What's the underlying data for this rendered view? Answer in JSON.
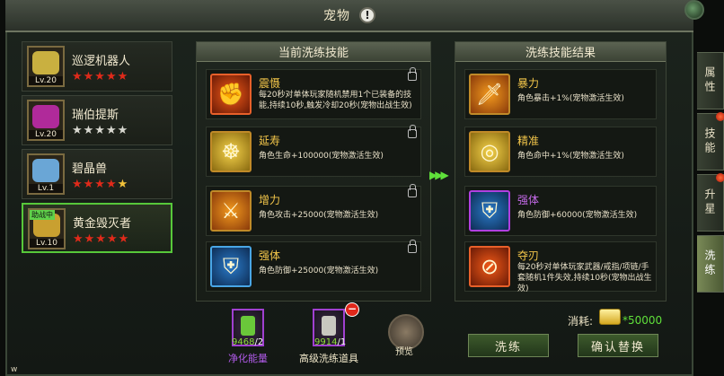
{
  "window": {
    "title": "宠物",
    "corner_mark": "w"
  },
  "pets": [
    {
      "name": "巡逻机器人",
      "level": "Lv.20",
      "stars": "★★★★★",
      "star_style": "red",
      "color": "#c9b040"
    },
    {
      "name": "瑞伯提斯",
      "level": "Lv.20",
      "stars": "★★★★★",
      "star_style": "empty",
      "color": "#b02a9a"
    },
    {
      "name": "碧晶兽",
      "level": "Lv.1",
      "stars_red": "★★★★",
      "stars_gold": "★",
      "star_style": "mixed",
      "color": "#6aa6d6"
    },
    {
      "name": "黄金毁灭者",
      "level": "Lv.10",
      "stars": "★★★★★",
      "star_style": "red",
      "color": "#c9a030",
      "badge": "助战中",
      "selected": true
    }
  ],
  "current_panel": {
    "title": "当前洗练技能",
    "skills": [
      {
        "name": "震慑",
        "desc": "每20秒对单体玩家随机禁用1个已装备的技能,持续10秒,触发冷却20秒(宠物出战生效)",
        "icon": "fist-icon"
      },
      {
        "name": "延寿",
        "desc": "角色生命+100000(宠物激活生效)",
        "icon": "meditation-icon"
      },
      {
        "name": "增力",
        "desc": "角色攻击+25000(宠物激活生效)",
        "icon": "crossed-swords-icon"
      },
      {
        "name": "强体",
        "desc": "角色防御+25000(宠物激活生效)",
        "icon": "shield-icon"
      }
    ]
  },
  "result_panel": {
    "title": "洗练技能结果",
    "skills": [
      {
        "name": "暴力",
        "desc": "角色暴击+1%(宠物激活生效)",
        "icon": "sword-strike-icon"
      },
      {
        "name": "精准",
        "desc": "角色命中+1%(宠物激活生效)",
        "icon": "target-icon"
      },
      {
        "name": "强体",
        "desc": "角色防御+60000(宠物激活生效)",
        "icon": "shield-icon"
      },
      {
        "name": "夺刃",
        "desc": "每20秒对单体玩家武器/戒指/项链/手套随机1件失效,持续10秒(宠物出战生效)",
        "icon": "disarm-icon"
      }
    ]
  },
  "tabs": [
    {
      "label": "属性",
      "dot": false
    },
    {
      "label": "技能",
      "dot": true
    },
    {
      "label": "升星",
      "dot": true
    },
    {
      "label": "洗练",
      "dot": false,
      "active": true
    }
  ],
  "items": [
    {
      "name": "净化能量",
      "have": "9468",
      "need": "2",
      "label_color": "#b05ae8"
    },
    {
      "name": "高级洗练道具",
      "have": "9914",
      "need": "1",
      "label_color": "#efe6c8"
    }
  ],
  "preview_label": "预览",
  "cost": {
    "label": "消耗:",
    "value": "*50000"
  },
  "buttons": {
    "refine": "洗练",
    "confirm": "确认替换"
  }
}
